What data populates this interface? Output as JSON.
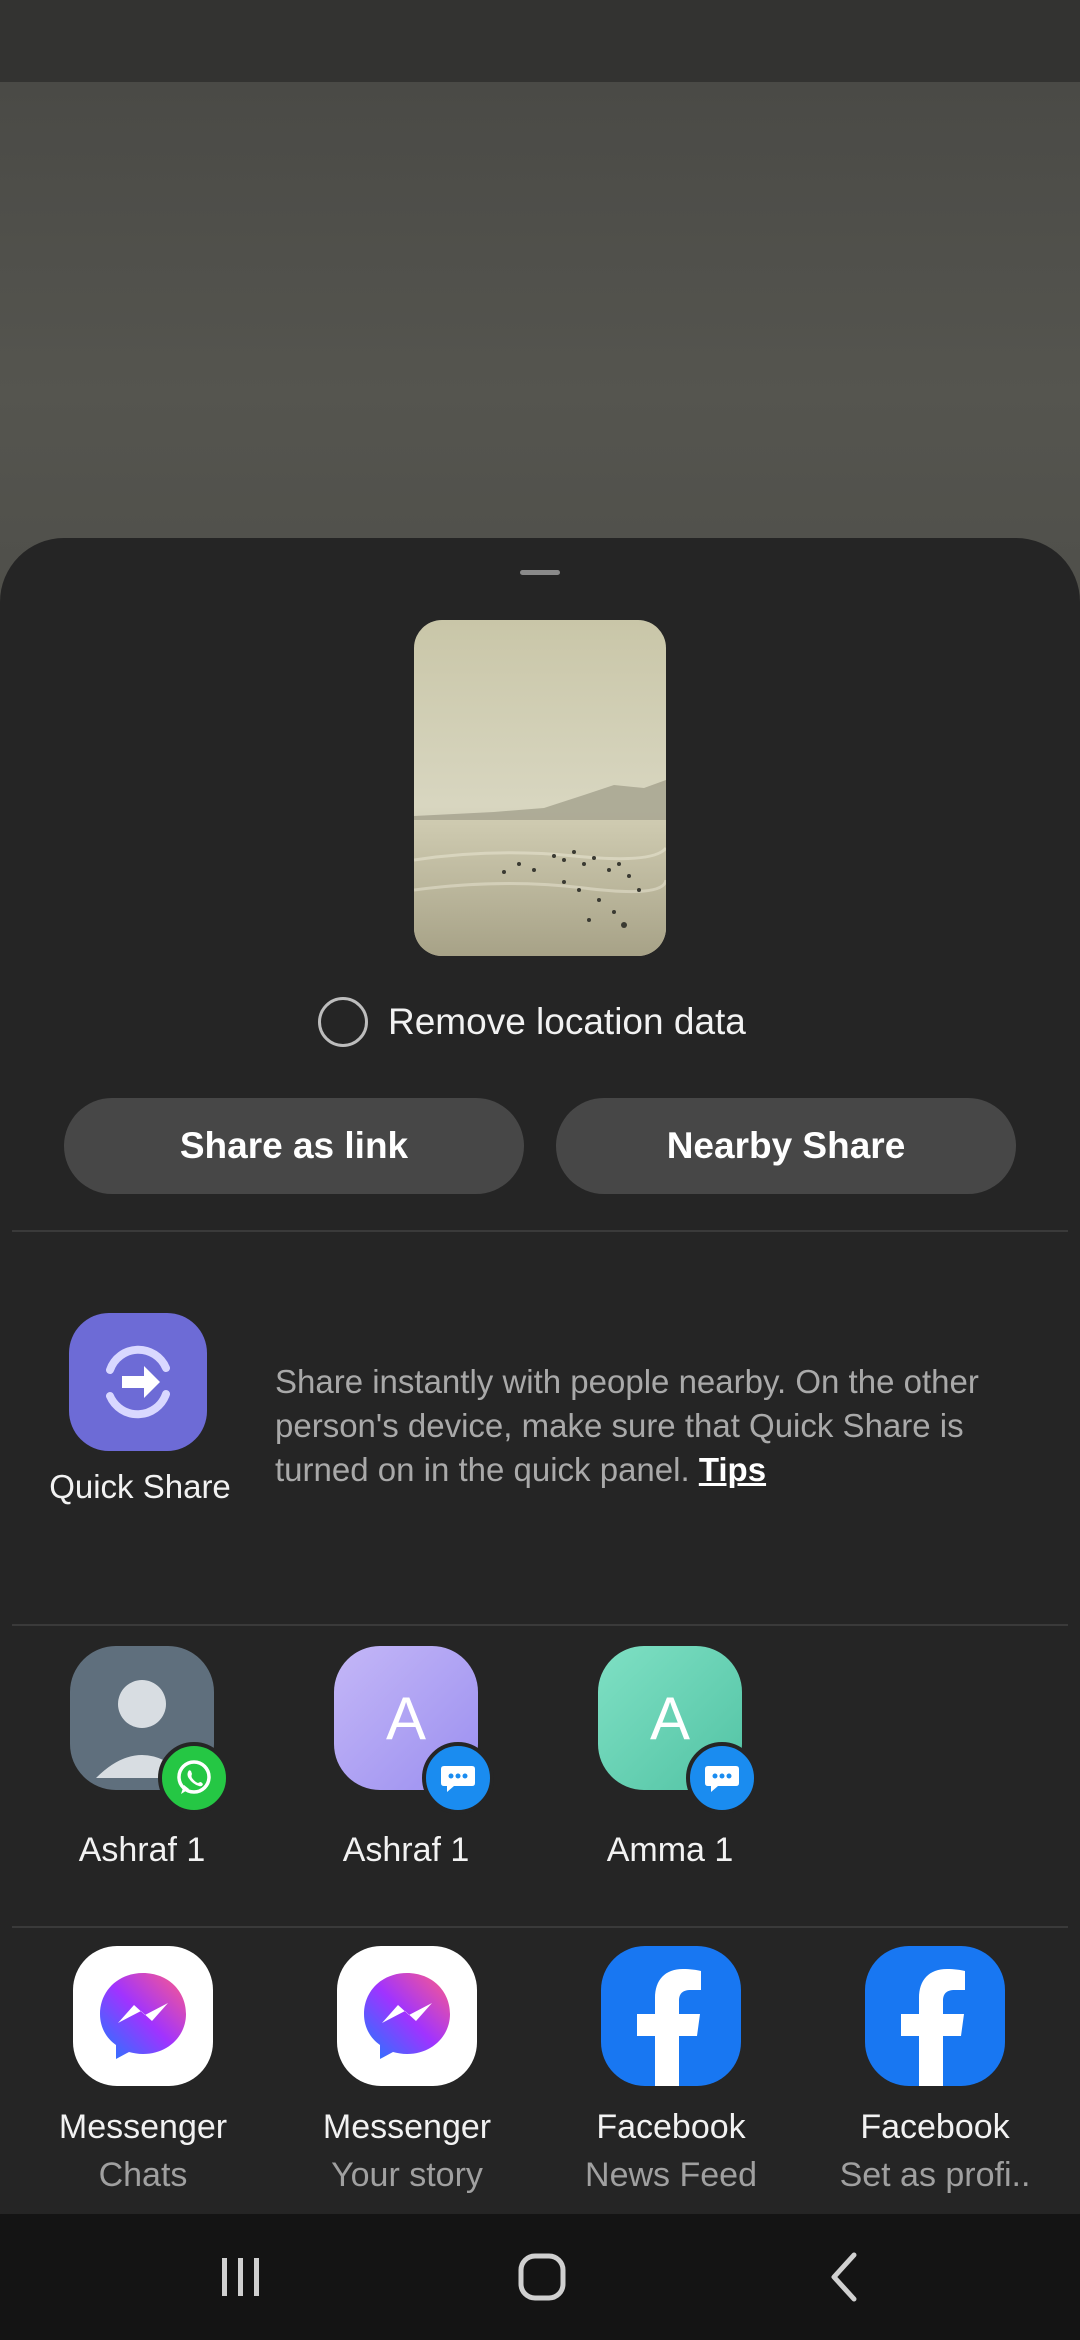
{
  "sheet": {
    "remove_location_label": "Remove location data",
    "share_as_link_label": "Share as link",
    "nearby_share_label": "Nearby Share"
  },
  "quick_share": {
    "label": "Quick Share",
    "description": "Share instantly with people nearby. On the other person's device, make sure that Quick Share is turned on in the quick panel.",
    "tips_label": "Tips"
  },
  "contacts": [
    {
      "name": "Ashraf 1",
      "initial": "",
      "avatar_color": "#5f6f7d",
      "badge": "whatsapp-icon",
      "badge_color": "#25c744"
    },
    {
      "name": "Ashraf 1",
      "initial": "A",
      "avatar_color": "#a8a0f0",
      "badge": "message-icon",
      "badge_color": "#1a8cf0"
    },
    {
      "name": "Amma 1",
      "initial": "A",
      "avatar_color": "#6fd3b8",
      "badge": "message-icon",
      "badge_color": "#1a8cf0"
    }
  ],
  "apps": [
    {
      "name": "Messenger",
      "sub": "Chats",
      "icon": "messenger-icon"
    },
    {
      "name": "Messenger",
      "sub": "Your story",
      "icon": "messenger-icon"
    },
    {
      "name": "Facebook",
      "sub": "News Feed",
      "icon": "facebook-icon"
    },
    {
      "name": "Facebook",
      "sub": "Set as profi..",
      "icon": "facebook-icon"
    }
  ],
  "colors": {
    "sheet_bg": "#252525",
    "pill_bg": "#474747",
    "quick_share_accent": "#6d6bd6",
    "facebook_blue": "#1877f2"
  }
}
